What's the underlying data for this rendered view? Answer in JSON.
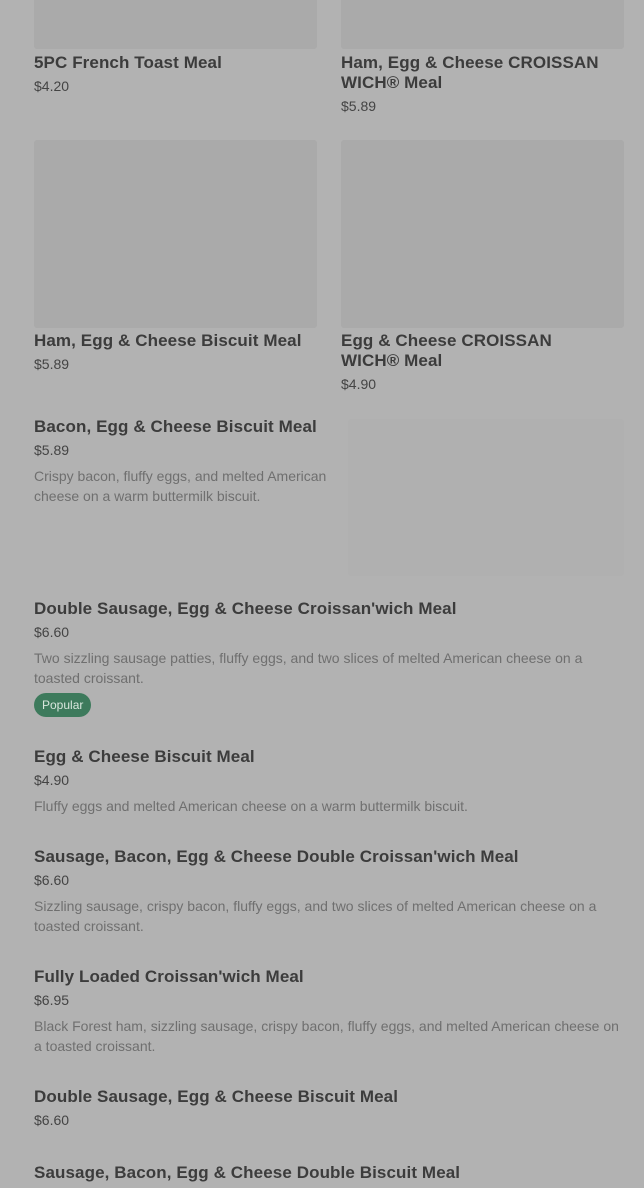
{
  "grid": [
    {
      "name": "5PC French Toast Meal",
      "price": "$4.20"
    },
    {
      "name": "Ham, Egg & Cheese CROISSAN WICH® Meal",
      "price": "$5.89"
    },
    {
      "name": "Ham, Egg & Cheese Biscuit Meal",
      "price": "$5.89"
    },
    {
      "name": "Egg & Cheese CROISSAN WICH® Meal",
      "price": "$4.90"
    }
  ],
  "list": [
    {
      "name": "Bacon, Egg & Cheese Biscuit Meal",
      "price": "$5.89",
      "desc": "Crispy bacon, fluffy eggs, and melted American cheese on a warm buttermilk biscuit."
    },
    {
      "name": "Double Sausage, Egg & Cheese Croissan'wich Meal",
      "price": "$6.60",
      "desc": "Two sizzling sausage patties, fluffy eggs, and two slices of melted American cheese on a toasted croissant.",
      "badge": "Popular"
    },
    {
      "name": "Egg & Cheese Biscuit Meal",
      "price": "$4.90",
      "desc": "Fluffy eggs and melted American cheese on a warm buttermilk biscuit."
    },
    {
      "name": "Sausage, Bacon, Egg & Cheese Double Croissan'wich Meal",
      "price": "$6.60",
      "desc": "Sizzling sausage, crispy bacon, fluffy eggs, and two slices of melted American cheese on a toasted croissant."
    },
    {
      "name": "Fully Loaded Croissan'wich Meal",
      "price": "$6.95",
      "desc": "Black Forest ham, sizzling sausage, crispy bacon, fluffy eggs, and melted American cheese on a toasted croissant."
    },
    {
      "name": "Double Sausage, Egg & Cheese Biscuit Meal",
      "price": "$6.60"
    },
    {
      "name": "Sausage, Bacon, Egg & Cheese Double Biscuit Meal"
    }
  ]
}
